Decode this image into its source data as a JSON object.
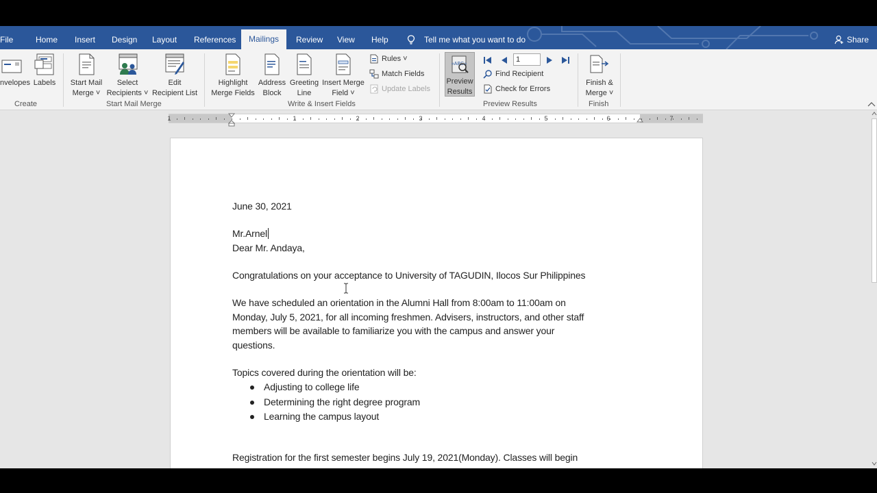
{
  "tabs": {
    "file": "File",
    "home": "Home",
    "insert": "Insert",
    "design": "Design",
    "layout": "Layout",
    "references": "References",
    "mailings": "Mailings",
    "review": "Review",
    "view": "View",
    "help": "Help"
  },
  "tell_me": "Tell me what you want to do",
  "share": "Share",
  "ribbon": {
    "create": {
      "envelopes": "nvelopes",
      "labels": "Labels",
      "group": "Create"
    },
    "start_mail_merge": {
      "start_l1": "Start Mail",
      "start_l2": "Merge ˅",
      "select_l1": "Select",
      "select_l2": "Recipients ˅",
      "edit_l1": "Edit",
      "edit_l2": "Recipient List",
      "group": "Start Mail Merge"
    },
    "write_insert": {
      "highlight_l1": "Highlight",
      "highlight_l2": "Merge Fields",
      "address_l1": "Address",
      "address_l2": "Block",
      "greeting_l1": "Greeting",
      "greeting_l2": "Line",
      "insert_l1": "Insert Merge",
      "insert_l2": "Field ˅",
      "rules": "Rules ˅",
      "match_fields": "Match Fields",
      "update_labels": "Update Labels",
      "group": "Write & Insert Fields"
    },
    "preview": {
      "preview_l1": "Preview",
      "preview_l2": "Results",
      "record": "1",
      "find_recipient": "Find Recipient",
      "check_errors": "Check for Errors",
      "group": "Preview Results"
    },
    "finish": {
      "finish_l1": "Finish &",
      "finish_l2": "Merge ˅",
      "group": "Finish"
    }
  },
  "ruler_numbers": [
    "1",
    "1",
    "2",
    "3",
    "4",
    "5",
    "6",
    "7"
  ],
  "document": {
    "date": "June 30, 2021",
    "name": "Mr.Arnel",
    "salutation": "Dear Mr. Andaya,",
    "congrats": "Congratulations on your acceptance to University of TAGUDIN, Ilocos Sur Philippines",
    "para1_l1": "We have scheduled an orientation in the Alumni Hall from 8:00am to 11:00am on",
    "para1_l2": "Monday, July 5, 2021, for all incoming freshmen. Advisers, instructors, and other staff",
    "para1_l3": "members will be available to familiarize you with the campus and answer your",
    "para1_l4": "questions.",
    "topics_intro": "Topics covered during the orientation will be:",
    "topics": [
      "Adjusting to college life",
      "Determining the right degree program",
      "Learning the campus layout"
    ],
    "registration": "Registration for the first semester begins July 19, 2021(Monday). Classes will begin"
  },
  "colors": {
    "tabbar": "#2b579a",
    "ribbon": "#f3f3f3",
    "canvas": "#e6e6e6"
  }
}
